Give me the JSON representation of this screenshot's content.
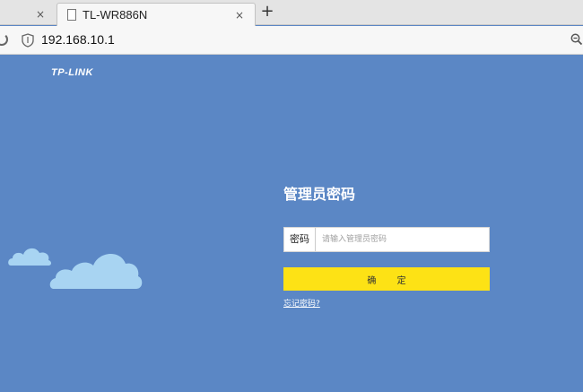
{
  "browser": {
    "tab_title": "TL-WR886N",
    "inactive_tab_close": "×",
    "active_tab_close": "×",
    "new_tab": "+",
    "url": "192.168.10.1",
    "icons": [
      "reload-icon",
      "shield-icon",
      "page-icon",
      "zoom-icon"
    ]
  },
  "page": {
    "brand": "TP-LINK",
    "title": "管理员密码",
    "password_label": "密码",
    "password_placeholder": "请输入管理员密码",
    "password_value": "",
    "confirm_button": "确 定",
    "forgot_link": "忘记密码?"
  },
  "colors": {
    "background": "#5b87c5",
    "button": "#fde215",
    "cloud": "#a8d4f2"
  }
}
